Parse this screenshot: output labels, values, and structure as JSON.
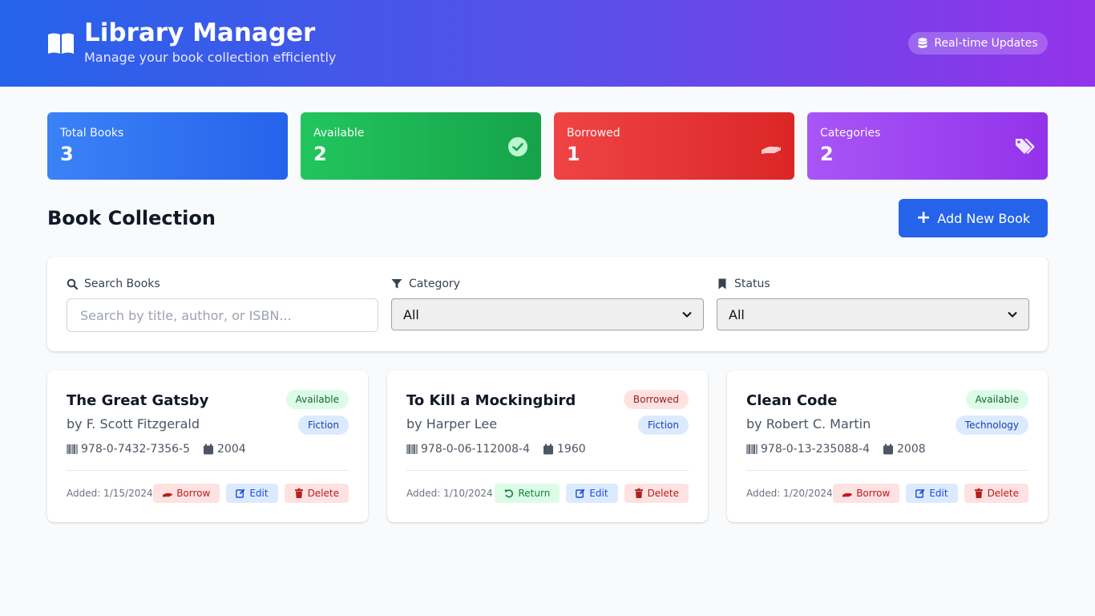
{
  "header": {
    "title": "Library Manager",
    "subtitle": "Manage your book collection efficiently",
    "badge": "Real-time Updates",
    "logo_icon": "book-open-icon",
    "badge_icon": "database-icon"
  },
  "stats": [
    {
      "label": "Total Books",
      "value": "3",
      "color": "#2563eb",
      "icon": "book-icon"
    },
    {
      "label": "Available",
      "value": "2",
      "color": "#16a34a",
      "icon": "check-circle-icon"
    },
    {
      "label": "Borrowed",
      "value": "1",
      "color": "#dc2626",
      "icon": "hand-holding-icon"
    },
    {
      "label": "Categories",
      "value": "2",
      "color": "#9333ea",
      "icon": "tags-icon"
    }
  ],
  "collection": {
    "title": "Book Collection",
    "add_button": "Add New Book"
  },
  "filters": {
    "search_label": "Search Books",
    "search_placeholder": "Search by title, author, or ISBN...",
    "search_value": "",
    "category_label": "Category",
    "category_value": "All",
    "status_label": "Status",
    "status_value": "All"
  },
  "books": [
    {
      "title": "The Great Gatsby",
      "author": "by F. Scott Fitzgerald",
      "status": "Available",
      "category": "Fiction",
      "isbn": "978-0-7432-7356-5",
      "year": "2004",
      "added": "Added: 1/15/2024",
      "primary_action": "Borrow",
      "edit": "Edit",
      "delete": "Delete"
    },
    {
      "title": "To Kill a Mockingbird",
      "author": "by Harper Lee",
      "status": "Borrowed",
      "category": "Fiction",
      "isbn": "978-0-06-112008-4",
      "year": "1960",
      "added": "Added: 1/10/2024",
      "primary_action": "Return",
      "edit": "Edit",
      "delete": "Delete"
    },
    {
      "title": "Clean Code",
      "author": "by Robert C. Martin",
      "status": "Available",
      "category": "Technology",
      "isbn": "978-0-13-235088-4",
      "year": "2008",
      "added": "Added: 1/20/2024",
      "primary_action": "Borrow",
      "edit": "Edit",
      "delete": "Delete"
    }
  ]
}
